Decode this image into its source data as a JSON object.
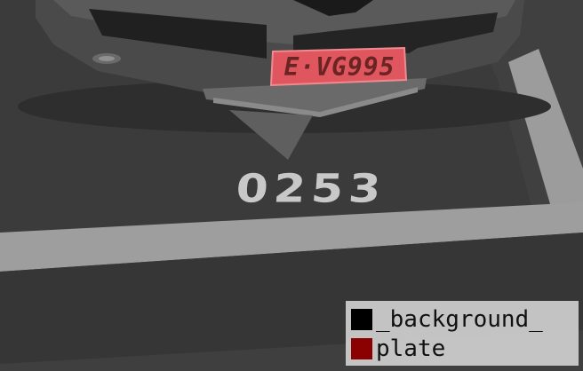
{
  "plate": {
    "text": "E·VG995"
  },
  "stall": {
    "number": "0253"
  },
  "legend": {
    "items": [
      {
        "label": "_background_",
        "color": "#000000"
      },
      {
        "label": "plate",
        "color": "#8b0000"
      }
    ]
  }
}
